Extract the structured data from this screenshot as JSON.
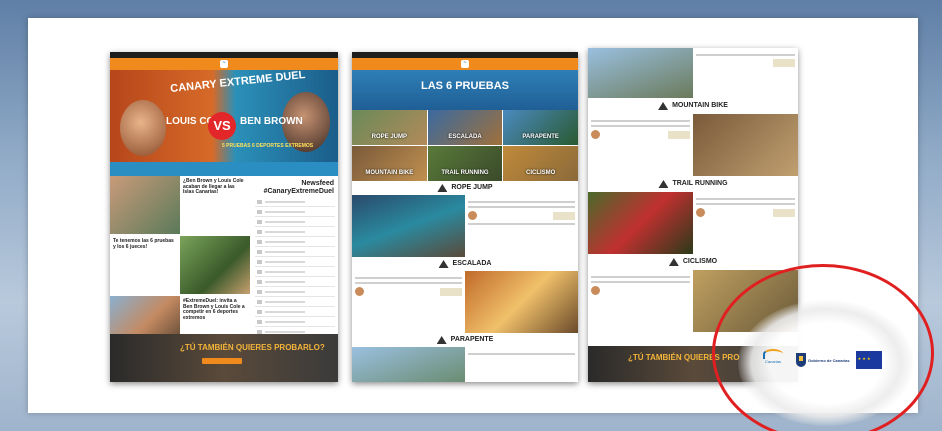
{
  "page1": {
    "hero_title": "CANARY EXTREME DUEL",
    "player1": "LOUIS COLE",
    "vs": "VS",
    "player2": "BEN BROWN",
    "hero_sub": "5 PRUEBAS 6 DEPORTES EXTREMOS",
    "newsfeed_title": "Newsfeed #CanaryExtremeDuel",
    "cards": [
      {
        "title": "¿Ben Brown y Louis Cole acaban de llegar a las Islas Canarias!"
      },
      {
        "title": "Te tenemos las 6 pruebas y los 6 jueces!"
      },
      {
        "title": "#ExtremeDuel: invita a Ben Brown y Louis Cole a competir en 6 deportes extremos"
      }
    ],
    "cta": "¿TÚ TAMBIÉN QUIERES PROBARLO?"
  },
  "page2": {
    "hero_title": "LAS 6 PRUEBAS",
    "tiles": [
      "ROPE JUMP",
      "ESCALADA",
      "PARAPENTE",
      "MOUNTAIN BIKE",
      "TRAIL RUNNING",
      "CICLISMO"
    ],
    "sections": [
      "ROPE JUMP",
      "ESCALADA",
      "PARAPENTE"
    ]
  },
  "page3": {
    "sections": [
      "MOUNTAIN BIKE",
      "TRAIL RUNNING",
      "CICLISMO"
    ],
    "cta": "¿TÚ TAMBIÉN QUIERES PRO"
  },
  "logos": {
    "a": "Canarias",
    "b": "Gobierno de Canarias"
  },
  "colors": {
    "accent": "#f08a1d",
    "highlight": "#e02020",
    "blue": "#2b8ec2"
  }
}
